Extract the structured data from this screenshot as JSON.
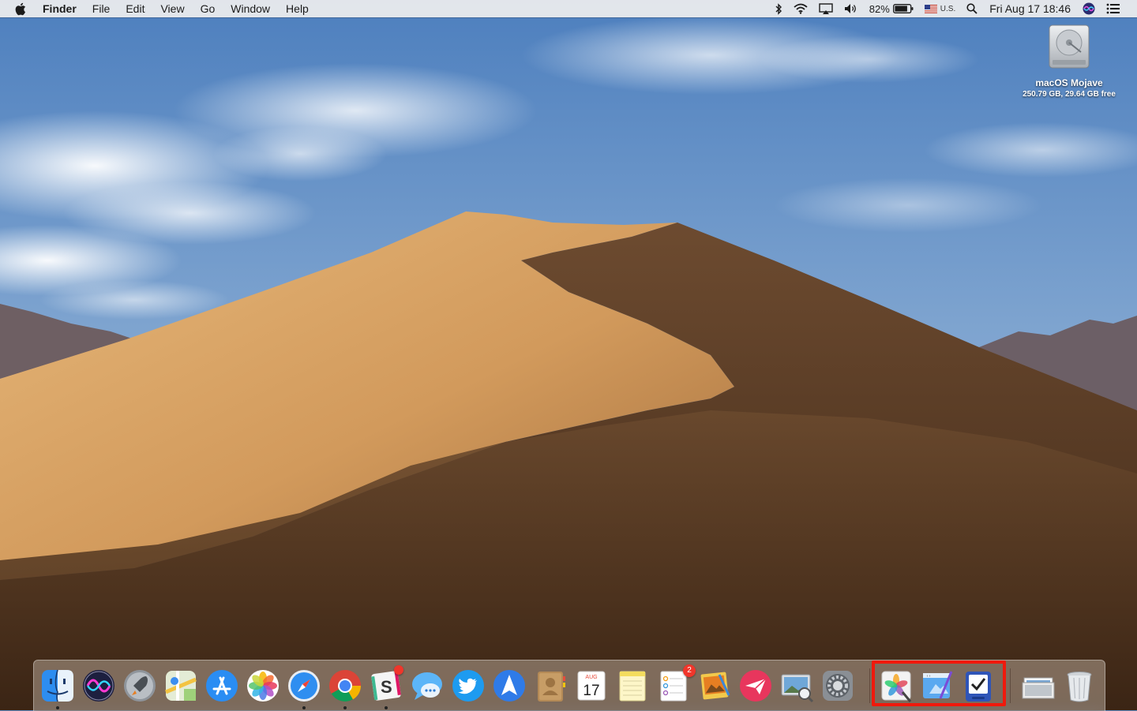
{
  "menubar": {
    "app_name": "Finder",
    "menus": [
      "File",
      "Edit",
      "View",
      "Go",
      "Window",
      "Help"
    ],
    "battery_percent": "82%",
    "input_source": "U.S.",
    "clock": "Fri Aug 17  18:46"
  },
  "desktop": {
    "disk_name": "macOS Mojave",
    "disk_info": "250.79 GB, 29.64 GB free"
  },
  "dock": {
    "messages_badge": "",
    "reminders_badge": "2",
    "calendar_month": "AUG",
    "calendar_day": "17",
    "icons": [
      "finder-icon",
      "siri-icon",
      "launchpad-icon",
      "maps-icon",
      "app-store-icon",
      "photos-icon",
      "safari-icon",
      "chrome-icon",
      "slack-icon",
      "messages-icon",
      "twitter-icon",
      "spark-icon",
      "contacts-icon",
      "calendar-icon",
      "notes-icon",
      "reminders-icon",
      "preview-icon",
      "airmail-icon",
      "image-capture-icon",
      "system-preferences-icon",
      "pixelmator-icon",
      "sketch-icon",
      "omnifocus-icon",
      "downloads-stack-icon",
      "trash-icon"
    ]
  },
  "colors": {
    "highlight": "#f0190c",
    "sky": "#5f86b8",
    "dune_light": "#d9a86a",
    "dune_shadow": "#5b3d26"
  }
}
